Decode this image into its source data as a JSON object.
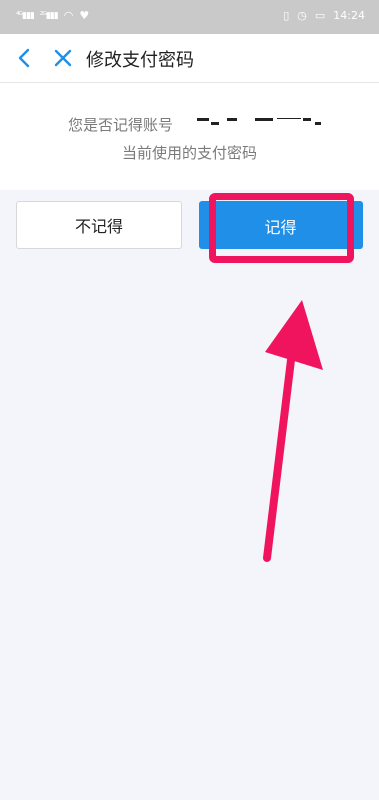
{
  "status_bar": {
    "left_icons": [
      "signal-icon",
      "signal-icon",
      "wifi-icon",
      "heart-icon"
    ],
    "right_icons": [
      "vibrate-icon",
      "alarm-icon",
      "battery-icon"
    ],
    "time": "14:24"
  },
  "header": {
    "title": "修改支付密码",
    "back_icon": "chevron-left-icon",
    "close_icon": "close-icon"
  },
  "message": {
    "line1_prefix": "您是否记得账号",
    "line2": "当前使用的支付密码"
  },
  "buttons": {
    "forgot_label": "不记得",
    "remember_label": "记得"
  },
  "colors": {
    "accent": "#1f8fe8",
    "highlight": "#f0145f",
    "background": "#f4f5fb"
  }
}
